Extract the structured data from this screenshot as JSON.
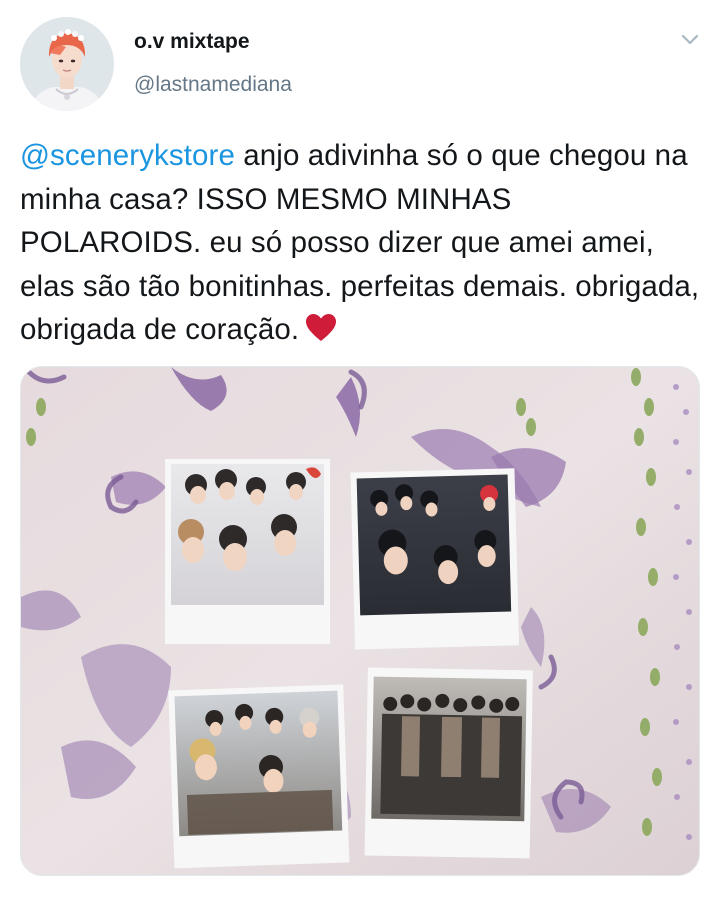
{
  "tweet": {
    "display_name": "o.v mixtape",
    "handle": "@lastnamediana",
    "text": {
      "mention": "@scenerykstore",
      "body": " anjo adivinha só o que chegou na minha casa? ISSO MESMO MINHAS POLAROIDS. eu só posso dizer que amei amei, elas são tão bonitinhas. perfeitas demais. obrigada, obrigada de coração."
    },
    "heart_emoji": "red-heart-icon"
  },
  "colors": {
    "text": "#14171a",
    "secondary": "#657786",
    "link": "#1b95e0",
    "heart": "#cf1c39"
  }
}
